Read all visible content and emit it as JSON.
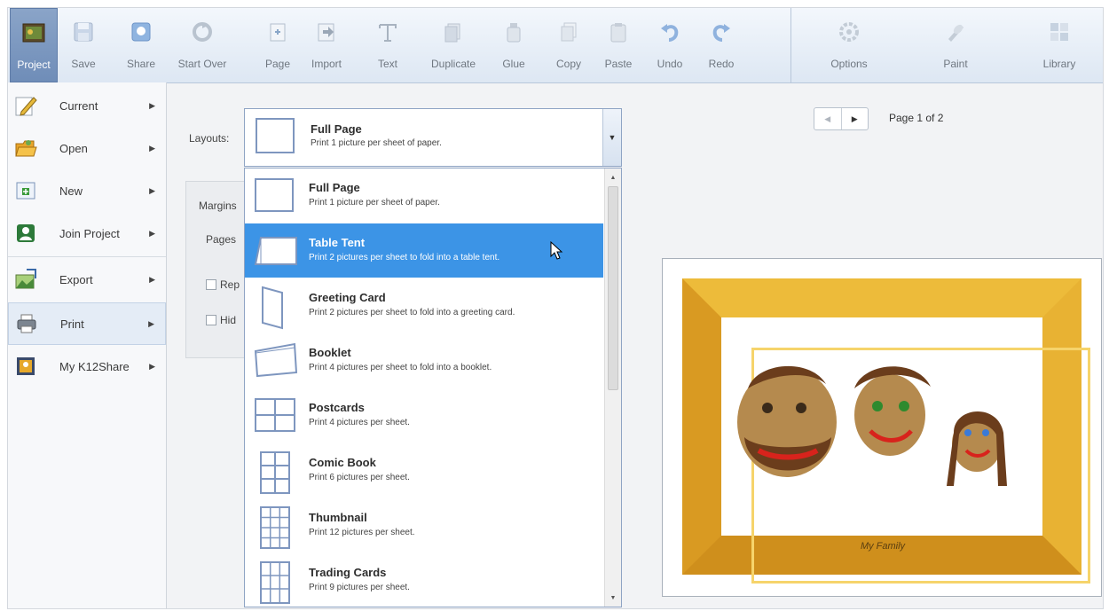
{
  "toolbar": {
    "buttons": [
      {
        "label": "Project",
        "icon": "project-icon"
      },
      {
        "label": "Save",
        "icon": "save-icon"
      },
      {
        "label": "Share",
        "icon": "share-icon"
      },
      {
        "label": "Start Over",
        "icon": "start-over-icon"
      },
      {
        "label": "Page",
        "icon": "page-icon"
      },
      {
        "label": "Import",
        "icon": "import-icon"
      },
      {
        "label": "Text",
        "icon": "text-icon"
      },
      {
        "label": "Duplicate",
        "icon": "duplicate-icon"
      },
      {
        "label": "Glue",
        "icon": "glue-icon"
      },
      {
        "label": "Copy",
        "icon": "copy-icon"
      },
      {
        "label": "Paste",
        "icon": "paste-icon"
      },
      {
        "label": "Undo",
        "icon": "undo-icon"
      },
      {
        "label": "Redo",
        "icon": "redo-icon"
      },
      {
        "label": "Options",
        "icon": "options-icon"
      },
      {
        "label": "Paint",
        "icon": "paint-icon"
      },
      {
        "label": "Library",
        "icon": "library-icon"
      }
    ]
  },
  "menu": {
    "items": [
      {
        "label": "Current",
        "icon": "pencil-icon"
      },
      {
        "label": "Open",
        "icon": "folder-open-icon"
      },
      {
        "label": "New",
        "icon": "new-project-icon"
      },
      {
        "label": "Join Project",
        "icon": "join-project-icon"
      },
      {
        "label": "Export",
        "icon": "export-icon"
      },
      {
        "label": "Print",
        "icon": "printer-icon"
      },
      {
        "label": "My K12Share",
        "icon": "k12share-icon"
      }
    ],
    "selected": "Print"
  },
  "layouts": {
    "label": "Layouts:",
    "selected": {
      "title": "Full Page",
      "desc": "Print 1 picture per sheet of paper."
    },
    "options": [
      {
        "title": "Full Page",
        "desc": "Print 1 picture per sheet of paper.",
        "icon": "full-page-layout-icon"
      },
      {
        "title": "Table Tent",
        "desc": "Print 2 pictures per sheet to fold into a table tent.",
        "icon": "table-tent-layout-icon"
      },
      {
        "title": "Greeting Card",
        "desc": "Print 2 pictures per sheet to fold into a greeting card.",
        "icon": "greeting-card-layout-icon"
      },
      {
        "title": "Booklet",
        "desc": "Print 4 pictures per sheet to fold into a booklet.",
        "icon": "booklet-layout-icon"
      },
      {
        "title": "Postcards",
        "desc": "Print 4 pictures per sheet.",
        "icon": "postcards-layout-icon"
      },
      {
        "title": "Comic Book",
        "desc": "Print 6 pictures per sheet.",
        "icon": "comic-book-layout-icon"
      },
      {
        "title": "Thumbnail",
        "desc": "Print 12 pictures per sheet.",
        "icon": "thumbnail-layout-icon"
      },
      {
        "title": "Trading Cards",
        "desc": "Print 9 pictures per sheet.",
        "icon": "trading-cards-layout-icon"
      }
    ],
    "highlighted": "Table Tent"
  },
  "options_panel": {
    "margins_label": "Margins",
    "pages_label": "Pages",
    "check1_label": "Rep",
    "check2_label": "Hid"
  },
  "pagination": {
    "indicator": "Page 1 of 2"
  },
  "preview": {
    "caption": "My Family"
  },
  "colors": {
    "accent": "#3c94e6",
    "frame_gold": "#e2a62a"
  }
}
